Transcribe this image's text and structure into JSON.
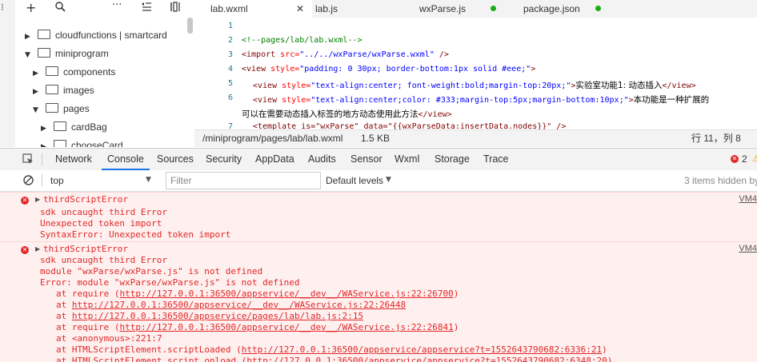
{
  "explorer": {
    "tree": [
      {
        "label": "cloudfunctions | smartcard",
        "expanded": false
      },
      {
        "label": "miniprogram",
        "expanded": true
      },
      {
        "label": "components",
        "expanded": false
      },
      {
        "label": "images",
        "expanded": false
      },
      {
        "label": "pages",
        "expanded": true
      },
      {
        "label": "cardBag",
        "expanded": false
      },
      {
        "label": "chooseCard",
        "expanded": false
      }
    ]
  },
  "editor": {
    "tabs": [
      {
        "label": "lab.wxml",
        "active": true
      },
      {
        "label": "lab.js",
        "active": false
      },
      {
        "label": "wxParse.js",
        "active": false
      },
      {
        "label": "package.json",
        "active": false
      }
    ],
    "line_numbers": [
      "1",
      "2",
      "3",
      "4",
      "5",
      "6",
      "",
      "7"
    ],
    "code": {
      "l2": "<!--pages/lab/lab.wxml-->",
      "l3_tag": "<import",
      "l3_attr": " src=",
      "l3_val": "\"../../wxParse/wxParse.wxml\"",
      "l3_end": " />",
      "l4_tag": "<view",
      "l4_attr": " style=",
      "l4_val": "\"padding: 0 30px; border-bottom:1px solid #eee;\"",
      "l4_end": ">",
      "l5_tag": "<view",
      "l5_attr": " style=",
      "l5_val": "\"text-align:center; font-weight:bold;margin-top:20px;\"",
      "l5_end": ">",
      "l5_text": "实验室功能1: 动态插入",
      "l5_close": "</view>",
      "l6_tag": "<view",
      "l6_attr": " style=",
      "l6_val": "\"text-align:center;color: #333;margin-top:5px;margin-bottom:10px;\"",
      "l6_end": ">",
      "l6_text": "本功能是一种扩展的",
      "l6b_text": "可以在需要动态插入标签的地方动态使用此方法",
      "l6b_close": "</view>",
      "l7": "<template is=\"wxParse\" data=\"{{wxParseData:insertData.nodes}}\" />"
    },
    "status": {
      "path": "/miniprogram/pages/lab/lab.wxml",
      "size": "1.5 KB",
      "position": "行 11，列 8"
    }
  },
  "devtools": {
    "tabs": [
      "Network",
      "Console",
      "Sources",
      "Security",
      "AppData",
      "Audits",
      "Sensor",
      "Wxml",
      "Storage",
      "Trace"
    ],
    "active_tab": "Console",
    "error_count": "2",
    "context": "top",
    "filter_placeholder": "Filter",
    "levels": "Default levels",
    "hidden_note": "3 items hidden by"
  },
  "console": {
    "messages": [
      {
        "title": "thirdScriptError",
        "source": "VM4",
        "lines": [
          "sdk uncaught third Error",
          "Unexpected token import",
          "SyntaxError: Unexpected token import"
        ]
      },
      {
        "title": "thirdScriptError",
        "source": "VM4",
        "lines": [
          "sdk uncaught third Error",
          "module \"wxParse/wxParse.js\" is not defined",
          "Error: module \"wxParse/wxParse.js\" is not defined"
        ],
        "stack": [
          {
            "prefix": "at require (",
            "link": "http://127.0.0.1:36500/appservice/__dev__/WAService.js:22:26700",
            "suffix": ")"
          },
          {
            "prefix": "at ",
            "link": "http://127.0.0.1:36500/appservice/__dev__/WAService.js:22:26448",
            "suffix": ""
          },
          {
            "prefix": "at ",
            "link": "http://127.0.0.1:36500/appservice/pages/lab/lab.js:2:15",
            "suffix": ""
          },
          {
            "prefix": "at require (",
            "link": "http://127.0.0.1:36500/appservice/__dev__/WAService.js:22:26841",
            "suffix": ")"
          },
          {
            "prefix": "at <anonymous>:221:7",
            "link": "",
            "suffix": ""
          },
          {
            "prefix": "at HTMLScriptElement.scriptLoaded (",
            "link": "http://127.0.0.1:36500/appservice/appservice?t=1552643790682:6336:21",
            "suffix": ")"
          },
          {
            "prefix": "at HTMLScriptElement.script.onload (",
            "link": "http://127.0.0.1:36500/appservice/appservice?t=1552643790682:6348:20",
            "suffix": ")"
          }
        ]
      }
    ]
  }
}
